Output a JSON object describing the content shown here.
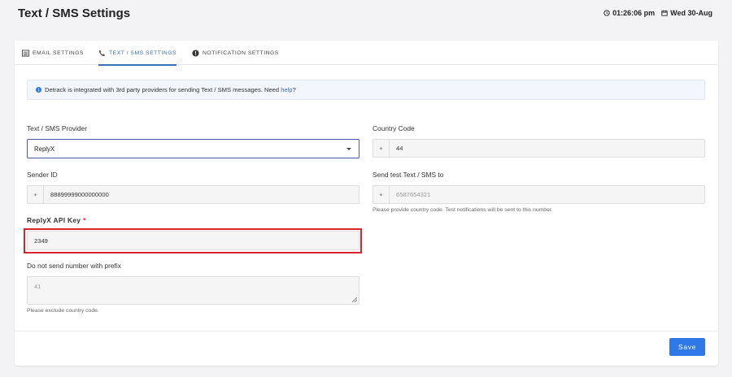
{
  "header": {
    "title": "Text / SMS Settings",
    "time": "01:26:06 pm",
    "date": "Wed 30-Aug"
  },
  "tabs": [
    {
      "label": "EMAIL SETTINGS",
      "icon": "list-icon",
      "active": false
    },
    {
      "label": "TEXT / SMS SETTINGS",
      "icon": "phone-icon",
      "active": true
    },
    {
      "label": "NOTIFICATION SETTINGS",
      "icon": "alert-circle-icon",
      "active": false
    }
  ],
  "info": {
    "text": "Detrack is integrated with 3rd party providers for sending Text / SMS messages. Need ",
    "link": "help",
    "suffix": "?"
  },
  "form": {
    "provider_label": "Text / SMS Provider",
    "provider_value": "ReplyX",
    "country_code_label": "Country Code",
    "country_code_prefix": "+",
    "country_code_value": "44",
    "sender_id_label": "Sender ID",
    "sender_id_prefix": "+",
    "sender_id_value": "88899999000000000",
    "test_label": "Send test Text / SMS to",
    "test_prefix": "+",
    "test_placeholder": "6587654321",
    "test_help": "Please provide country code. Test notifications will be sent to this number.",
    "api_key_label": "ReplyX API Key",
    "api_key_required": "*",
    "api_key_value": "2349",
    "prefix_label": "Do not send number with prefix",
    "prefix_placeholder": "41",
    "prefix_help": "Please exclude country code."
  },
  "actions": {
    "save_label": "Save"
  },
  "colors": {
    "accent": "#3b6fb6",
    "primary_button": "#2f78e8",
    "highlight": "#d9232d"
  }
}
